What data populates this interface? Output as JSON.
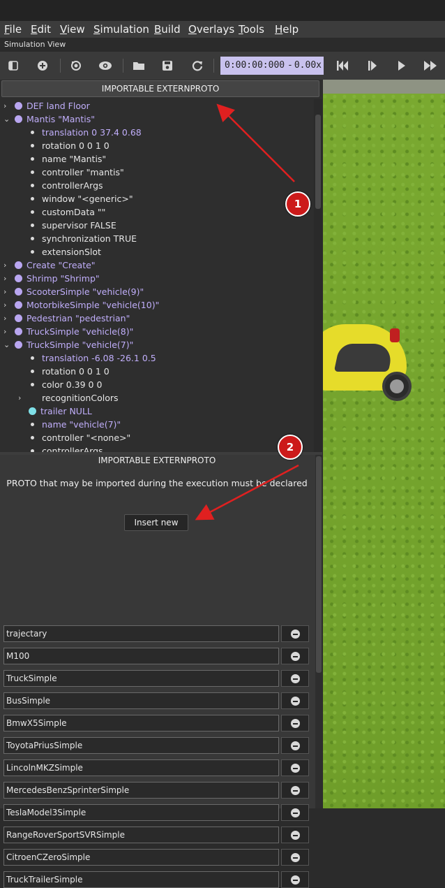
{
  "menu": [
    {
      "accel": "F",
      "rest": "ile"
    },
    {
      "accel": "E",
      "rest": "dit"
    },
    {
      "accel": "V",
      "rest": "iew"
    },
    {
      "accel": "S",
      "rest": "imulation"
    },
    {
      "accel": "B",
      "rest": "uild"
    },
    {
      "accel": "O",
      "rest": "verlays"
    },
    {
      "accel": "T",
      "rest": "ools"
    },
    {
      "accel": "H",
      "rest": "elp"
    }
  ],
  "simulation_view_label": "Simulation View",
  "toolbar": {
    "icons": [
      "toggle-scene-tree-icon",
      "add-node-icon",
      "reset-view-icon",
      "eye-icon",
      "open-world-icon",
      "save-world-icon",
      "reload-world-icon"
    ],
    "time": "0:00:00:000",
    "separator": "-",
    "speed": "0.00x",
    "playback_icons": [
      "reset-simulation-icon",
      "step-icon",
      "play-icon",
      "fast-forward-icon"
    ]
  },
  "scene_tree": {
    "header_button": "IMPORTABLE EXTERNPROTO",
    "rows": [
      {
        "kind": "node",
        "expand": "collapsed",
        "level": 0,
        "label": "DEF land Floor"
      },
      {
        "kind": "node",
        "expand": "expanded",
        "level": 0,
        "label": "Mantis \"Mantis\""
      },
      {
        "kind": "field",
        "level": 1,
        "label": "translation 0 37.4 0.68",
        "modified": true
      },
      {
        "kind": "field",
        "level": 1,
        "label": "rotation 0 0 1 0"
      },
      {
        "kind": "field",
        "level": 1,
        "label": "name \"Mantis\""
      },
      {
        "kind": "field",
        "level": 1,
        "label": "controller \"mantis\""
      },
      {
        "kind": "field",
        "level": 1,
        "label": "controllerArgs"
      },
      {
        "kind": "field",
        "level": 1,
        "label": "window \"<generic>\""
      },
      {
        "kind": "field",
        "level": 1,
        "label": "customData \"\""
      },
      {
        "kind": "field",
        "level": 1,
        "label": "supervisor FALSE"
      },
      {
        "kind": "field",
        "level": 1,
        "label": "synchronization TRUE"
      },
      {
        "kind": "field",
        "level": 1,
        "label": "extensionSlot"
      },
      {
        "kind": "node",
        "expand": "collapsed",
        "level": 0,
        "label": "Create \"Create\""
      },
      {
        "kind": "node",
        "expand": "collapsed",
        "level": 0,
        "label": "Shrimp \"Shrimp\""
      },
      {
        "kind": "node",
        "expand": "collapsed",
        "level": 0,
        "label": "ScooterSimple \"vehicle(9)\""
      },
      {
        "kind": "node",
        "expand": "collapsed",
        "level": 0,
        "label": "MotorbikeSimple \"vehicle(10)\""
      },
      {
        "kind": "node",
        "expand": "collapsed",
        "level": 0,
        "label": "Pedestrian \"pedestrian\""
      },
      {
        "kind": "node",
        "expand": "collapsed",
        "level": 0,
        "label": "TruckSimple \"vehicle(8)\""
      },
      {
        "kind": "node",
        "expand": "expanded",
        "level": 0,
        "label": "TruckSimple \"vehicle(7)\""
      },
      {
        "kind": "field",
        "level": 1,
        "label": "translation -6.08 -26.1 0.5",
        "modified": true
      },
      {
        "kind": "field",
        "level": 1,
        "label": "rotation 0 0 1 0"
      },
      {
        "kind": "field",
        "level": 1,
        "label": "color 0.39 0 0"
      },
      {
        "kind": "field",
        "level": 1,
        "expand": "collapsed",
        "label": "recognitionColors"
      },
      {
        "kind": "subnode",
        "level": 1,
        "label": "trailer NULL",
        "modified": true
      },
      {
        "kind": "field",
        "level": 1,
        "label": "name \"vehicle(7)\"",
        "modified": true
      },
      {
        "kind": "field",
        "level": 1,
        "label": "controller \"<none>\""
      },
      {
        "kind": "field",
        "level": 1,
        "label": "controllerArgs"
      }
    ]
  },
  "externproto_panel": {
    "title": "IMPORTABLE EXTERNPROTO",
    "description": "PROTO that may be imported during the execution must be declared",
    "insert_button": "Insert new",
    "entries": [
      "trajectary",
      "M100",
      "TruckSimple",
      "BusSimple",
      "BmwX5Simple",
      "ToyotaPriusSimple",
      "LincolnMKZSimple",
      "MercedesBenzSprinterSimple",
      "TeslaModel3Simple",
      "RangeRoverSportSVRSimple",
      "CitroenCZeroSimple",
      "TruckTrailerSimple"
    ]
  },
  "annotations": [
    {
      "number": "1"
    },
    {
      "number": "2"
    }
  ],
  "colors": {
    "node_dot": "#b9a6f0",
    "modified_field_text": "#c0aefa",
    "subnode_dot": "#7fe0e8",
    "annotation_red": "#e02020",
    "time_box": "#c9c2ee",
    "grass": "#7aa930",
    "car_yellow": "#e6dc2a"
  }
}
